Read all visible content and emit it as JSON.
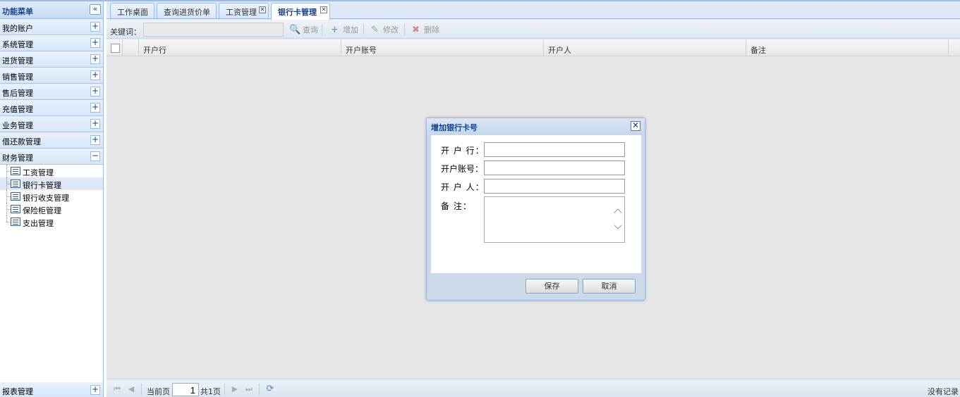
{
  "sidebar": {
    "title": "功能菜单",
    "collapse_icon": "«",
    "sections": [
      {
        "label": "我的账户",
        "toggle": "+"
      },
      {
        "label": "系统管理",
        "toggle": "+"
      },
      {
        "label": "进货管理",
        "toggle": "+"
      },
      {
        "label": "销售管理",
        "toggle": "+"
      },
      {
        "label": "售后管理",
        "toggle": "+"
      },
      {
        "label": "充值管理",
        "toggle": "+"
      },
      {
        "label": "业务管理",
        "toggle": "+"
      },
      {
        "label": "借还款管理",
        "toggle": "+"
      },
      {
        "label": "财务管理",
        "toggle": "−"
      }
    ],
    "tree_items": [
      {
        "label": "工资管理"
      },
      {
        "label": "银行卡管理"
      },
      {
        "label": "银行收支管理"
      },
      {
        "label": "保险柜管理"
      },
      {
        "label": "支出管理"
      }
    ],
    "bottom_section": {
      "label": "报表管理",
      "toggle": "+"
    }
  },
  "tabs": [
    {
      "label": "工作桌面"
    },
    {
      "label": "查询进货价单"
    },
    {
      "label": "工资管理",
      "close": "✕"
    },
    {
      "label": "银行卡管理",
      "close": "✕"
    }
  ],
  "toolbar": {
    "keyword_label": "关键词：",
    "keyword_value": "",
    "search": "查询",
    "add": "增加",
    "edit": "修改",
    "delete": "删除"
  },
  "grid": {
    "columns": [
      "开户行",
      "开户账号",
      "开户人",
      "备注"
    ]
  },
  "pager": {
    "first": "⏮",
    "prev": "◀",
    "current_label": "当前页",
    "page": "1",
    "total": "共1页",
    "next": "▶",
    "last": "⏭",
    "refresh": "⟳",
    "status": "没有记录"
  },
  "dialog": {
    "title": "增加银行卡号",
    "close": "✕",
    "fields": [
      {
        "label": "开 户 行：",
        "value": ""
      },
      {
        "label": "开户账号：",
        "value": ""
      },
      {
        "label": "开 户 人：",
        "value": ""
      },
      {
        "label": "备 注：",
        "value": ""
      }
    ],
    "save": "保存",
    "cancel": "取消"
  },
  "colors": {
    "accent": "#15428b",
    "border": "#99bbe8"
  }
}
